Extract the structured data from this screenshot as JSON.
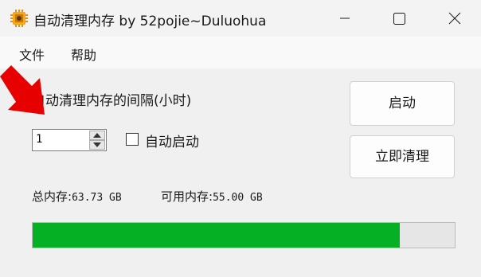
{
  "window": {
    "title": "自动清理内存 by 52pojie~Duluohua",
    "icons": {
      "app": "chip-icon",
      "minimize": "minimize-icon",
      "maximize": "maximize-icon",
      "close": "close-icon"
    }
  },
  "menu": {
    "file": "文件",
    "help": "帮助"
  },
  "form": {
    "interval_label": "自动清理内存的间隔(小时)",
    "interval_value": "1",
    "autostart_label": "自动启动",
    "autostart_checked": false
  },
  "buttons": {
    "start": "启动",
    "clean_now": "立即清理"
  },
  "memory": {
    "total_label": "总内存:",
    "total_value": "63.73 GB",
    "available_label": "可用内存:",
    "available_value": "55.00 GB",
    "usage_fraction": 0.869
  },
  "colors": {
    "progress_fill": "#06b025",
    "annotation_arrow": "#e60000"
  }
}
